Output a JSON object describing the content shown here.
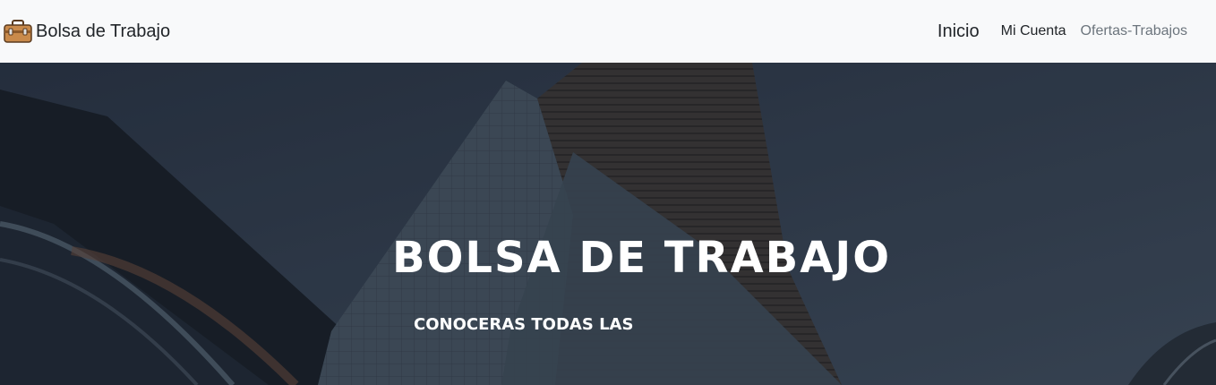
{
  "navbar": {
    "brand_icon": "briefcase-icon",
    "brand_text": "Bolsa de Trabajo",
    "links": {
      "inicio": "Inicio",
      "mi_cuenta": "Mi Cuenta",
      "ofertas": "Ofertas-Trabajos"
    }
  },
  "hero": {
    "title": "BOLSA DE TRABAJO",
    "subtitle": "CONOCERAS TODAS LAS"
  },
  "colors": {
    "navbar_bg": "#f8f9fa",
    "hero_overlay": "#2b3440",
    "text_light": "#ffffff",
    "link_muted": "#6c757d"
  }
}
